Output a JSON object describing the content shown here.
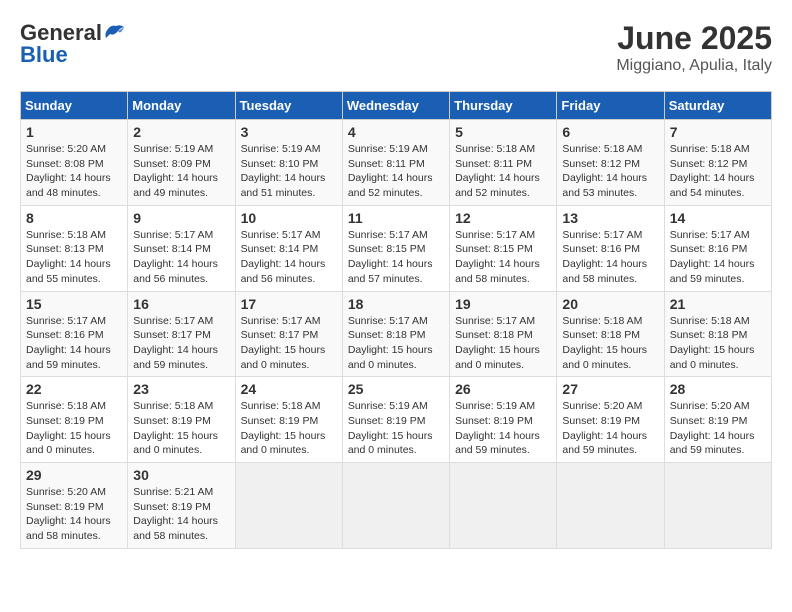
{
  "header": {
    "logo_general": "General",
    "logo_blue": "Blue",
    "month_title": "June 2025",
    "subtitle": "Miggiano, Apulia, Italy"
  },
  "weekdays": [
    "Sunday",
    "Monday",
    "Tuesday",
    "Wednesday",
    "Thursday",
    "Friday",
    "Saturday"
  ],
  "weeks": [
    [
      {
        "day": "1",
        "sunrise": "5:20 AM",
        "sunset": "8:08 PM",
        "daylight": "14 hours and 48 minutes."
      },
      {
        "day": "2",
        "sunrise": "5:19 AM",
        "sunset": "8:09 PM",
        "daylight": "14 hours and 49 minutes."
      },
      {
        "day": "3",
        "sunrise": "5:19 AM",
        "sunset": "8:10 PM",
        "daylight": "14 hours and 51 minutes."
      },
      {
        "day": "4",
        "sunrise": "5:19 AM",
        "sunset": "8:11 PM",
        "daylight": "14 hours and 52 minutes."
      },
      {
        "day": "5",
        "sunrise": "5:18 AM",
        "sunset": "8:11 PM",
        "daylight": "14 hours and 52 minutes."
      },
      {
        "day": "6",
        "sunrise": "5:18 AM",
        "sunset": "8:12 PM",
        "daylight": "14 hours and 53 minutes."
      },
      {
        "day": "7",
        "sunrise": "5:18 AM",
        "sunset": "8:12 PM",
        "daylight": "14 hours and 54 minutes."
      }
    ],
    [
      {
        "day": "8",
        "sunrise": "5:18 AM",
        "sunset": "8:13 PM",
        "daylight": "14 hours and 55 minutes."
      },
      {
        "day": "9",
        "sunrise": "5:17 AM",
        "sunset": "8:14 PM",
        "daylight": "14 hours and 56 minutes."
      },
      {
        "day": "10",
        "sunrise": "5:17 AM",
        "sunset": "8:14 PM",
        "daylight": "14 hours and 56 minutes."
      },
      {
        "day": "11",
        "sunrise": "5:17 AM",
        "sunset": "8:15 PM",
        "daylight": "14 hours and 57 minutes."
      },
      {
        "day": "12",
        "sunrise": "5:17 AM",
        "sunset": "8:15 PM",
        "daylight": "14 hours and 58 minutes."
      },
      {
        "day": "13",
        "sunrise": "5:17 AM",
        "sunset": "8:16 PM",
        "daylight": "14 hours and 58 minutes."
      },
      {
        "day": "14",
        "sunrise": "5:17 AM",
        "sunset": "8:16 PM",
        "daylight": "14 hours and 59 minutes."
      }
    ],
    [
      {
        "day": "15",
        "sunrise": "5:17 AM",
        "sunset": "8:16 PM",
        "daylight": "14 hours and 59 minutes."
      },
      {
        "day": "16",
        "sunrise": "5:17 AM",
        "sunset": "8:17 PM",
        "daylight": "14 hours and 59 minutes."
      },
      {
        "day": "17",
        "sunrise": "5:17 AM",
        "sunset": "8:17 PM",
        "daylight": "15 hours and 0 minutes."
      },
      {
        "day": "18",
        "sunrise": "5:17 AM",
        "sunset": "8:18 PM",
        "daylight": "15 hours and 0 minutes."
      },
      {
        "day": "19",
        "sunrise": "5:17 AM",
        "sunset": "8:18 PM",
        "daylight": "15 hours and 0 minutes."
      },
      {
        "day": "20",
        "sunrise": "5:18 AM",
        "sunset": "8:18 PM",
        "daylight": "15 hours and 0 minutes."
      },
      {
        "day": "21",
        "sunrise": "5:18 AM",
        "sunset": "8:18 PM",
        "daylight": "15 hours and 0 minutes."
      }
    ],
    [
      {
        "day": "22",
        "sunrise": "5:18 AM",
        "sunset": "8:19 PM",
        "daylight": "15 hours and 0 minutes."
      },
      {
        "day": "23",
        "sunrise": "5:18 AM",
        "sunset": "8:19 PM",
        "daylight": "15 hours and 0 minutes."
      },
      {
        "day": "24",
        "sunrise": "5:18 AM",
        "sunset": "8:19 PM",
        "daylight": "15 hours and 0 minutes."
      },
      {
        "day": "25",
        "sunrise": "5:19 AM",
        "sunset": "8:19 PM",
        "daylight": "15 hours and 0 minutes."
      },
      {
        "day": "26",
        "sunrise": "5:19 AM",
        "sunset": "8:19 PM",
        "daylight": "14 hours and 59 minutes."
      },
      {
        "day": "27",
        "sunrise": "5:20 AM",
        "sunset": "8:19 PM",
        "daylight": "14 hours and 59 minutes."
      },
      {
        "day": "28",
        "sunrise": "5:20 AM",
        "sunset": "8:19 PM",
        "daylight": "14 hours and 59 minutes."
      }
    ],
    [
      {
        "day": "29",
        "sunrise": "5:20 AM",
        "sunset": "8:19 PM",
        "daylight": "14 hours and 58 minutes."
      },
      {
        "day": "30",
        "sunrise": "5:21 AM",
        "sunset": "8:19 PM",
        "daylight": "14 hours and 58 minutes."
      },
      null,
      null,
      null,
      null,
      null
    ]
  ]
}
